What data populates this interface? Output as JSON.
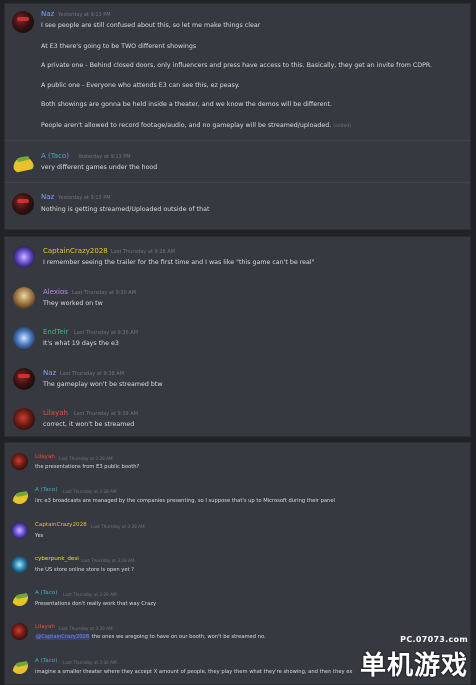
{
  "panel1": {
    "messages": [
      {
        "user": "Naz",
        "time": "Yesterday at 9:13 PM",
        "lines": [
          "I see people are still confused about this, so let me make things clear",
          "At E3 there's going to be TWO different showings",
          "A private one - Behind closed doors, only influencers and press have access to this. Basically, they get an invite from CDPR.",
          "A public one - Everyone who attends E3 can see this, ez peasy.",
          "Both showings are gonna be held inside a theater, and we know the demos will be different.",
          "People aren't allowed to record footage/audio, and no gameplay will be streamed/uploaded."
        ],
        "edited": "(edited)"
      },
      {
        "user": "A (Taco)",
        "time": "Yesterday at 9:13 PM",
        "lines": [
          "very different games under the hood"
        ]
      },
      {
        "user": "Naz",
        "time": "Yesterday at 9:13 PM",
        "lines": [
          "Nothing is getting streamed/Uploaded outside of that"
        ]
      }
    ]
  },
  "panel2": {
    "messages": [
      {
        "user": "CaptainCrazy2028",
        "time": "Last Thursday at 9:28 AM",
        "lines": [
          "I remember seeing the trailer for the first time and I was like \"this game can't be real\""
        ]
      },
      {
        "user": "Alexios",
        "time": "Last Thursday at 9:30 AM",
        "lines": [
          "They worked on tw"
        ]
      },
      {
        "user": "EndTeir",
        "time": "Last Thursday at 9:36 AM",
        "lines": [
          "It's what 19 days the e3"
        ]
      },
      {
        "user": "Naz",
        "time": "Last Thursday at 9:38 AM",
        "lines": [
          "The gameplay won't be streamed btw"
        ]
      },
      {
        "user": "Lilayah",
        "time": "Last Thursday at 9:39 AM",
        "lines": [
          "correct, it won't be streamed"
        ]
      }
    ]
  },
  "panel3": {
    "messages": [
      {
        "user": "Lilayah",
        "time": "Last Thursday at 3:28 AM",
        "lines": [
          "the presentations from E3 public booth?"
        ]
      },
      {
        "user": "A (Taco)",
        "time": "Last Thursday at 3:28 AM",
        "lines": [
          "iirc e3 broadcasts are managed by the companies presenting, so I suppose that's up to Microsoft during their panel"
        ]
      },
      {
        "user": "CaptainCrazy2028",
        "time": "Last Thursday at 3:28 AM",
        "lines": [
          "Yes"
        ]
      },
      {
        "user": "cyberpunk_desi",
        "time": "Last Thursday at 3:28 AM",
        "lines": [
          "the US store online store is open yet ?"
        ]
      },
      {
        "user": "A (Taco)",
        "time": "Last Thursday at 3:29 AM",
        "lines": [
          "Presentations don't really work that way Crazy"
        ]
      },
      {
        "user": "Lilayah",
        "time": "Last Thursday at 3:29 AM",
        "mention": "@CaptainCrazy2028",
        "lines": [
          " the ones we aregoing to have on our booth, won't be streamed no."
        ]
      },
      {
        "user": "A (Taco)",
        "time": "Last Thursday at 3:30 AM",
        "lines": [
          "imagine a smaller theater where they accept X amount of people, they play them what they're showing, and then they ex"
        ]
      }
    ]
  },
  "watermark": {
    "url": "PC.07073.com",
    "logo": "单机游戏"
  }
}
